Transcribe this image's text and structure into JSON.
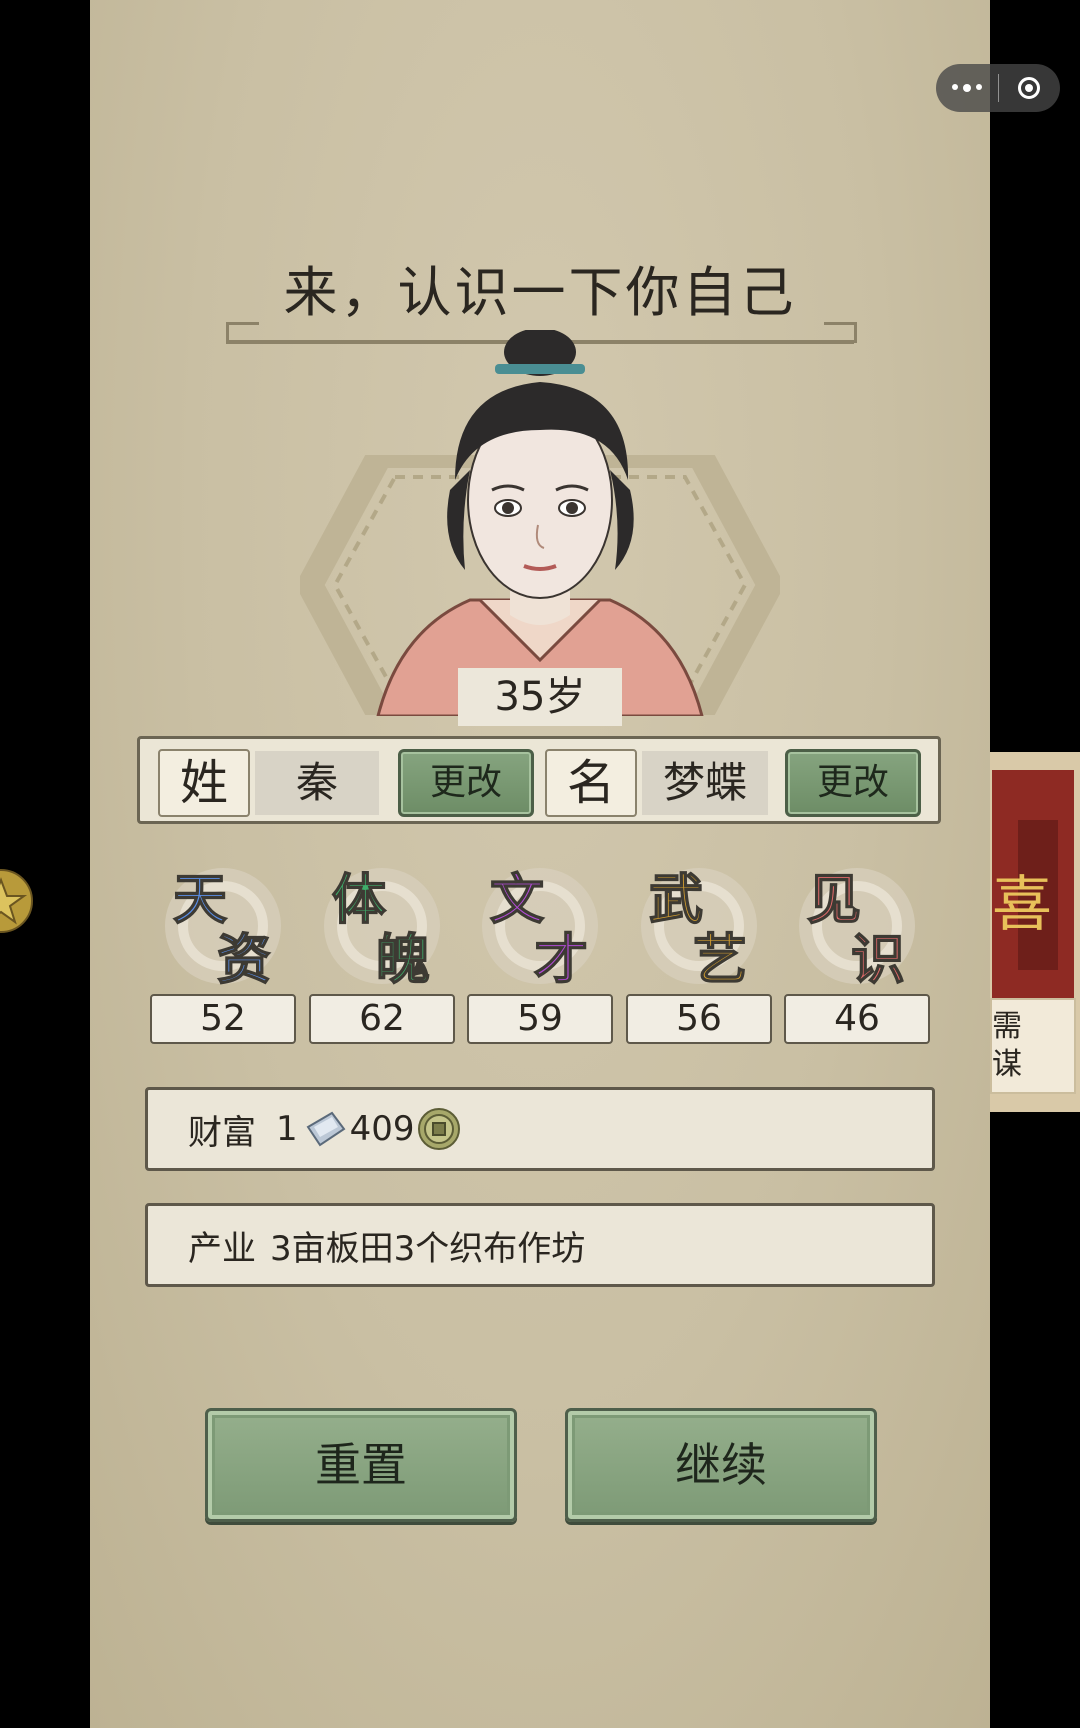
{
  "title": "来，认识一下你自己",
  "character": {
    "age_label": "35岁",
    "surname_tag": "姓",
    "surname_value": "秦",
    "given_tag": "名",
    "given_value": "梦蝶",
    "change_label": "更改"
  },
  "stats": [
    {
      "name_line1": "天",
      "name_line2": "资",
      "value": "52",
      "color": "#5a8fe8"
    },
    {
      "name_line1": "体",
      "name_line2": "魄",
      "value": "62",
      "color": "#3fae6b"
    },
    {
      "name_line1": "文",
      "name_line2": "才",
      "value": "59",
      "color": "#b24cd6"
    },
    {
      "name_line1": "武",
      "name_line2": "艺",
      "value": "56",
      "color": "#d6a02f"
    },
    {
      "name_line1": "见",
      "name_line2": "识",
      "value": "46",
      "color": "#e36b6b"
    }
  ],
  "wealth": {
    "label": "财富",
    "silver_count": "1",
    "coin_count": "409",
    "silver_icon": "silver-ingot-icon",
    "coin_icon": "copper-coin-icon"
  },
  "property": {
    "label": "产业",
    "text": "3亩板田3个织布作坊"
  },
  "buttons": {
    "reset": "重置",
    "continue": "继续"
  },
  "side_card": {
    "text": "需\n谋"
  },
  "colors": {
    "panel_bg": "#cbc1a5",
    "green_button": "#7d9a76"
  }
}
